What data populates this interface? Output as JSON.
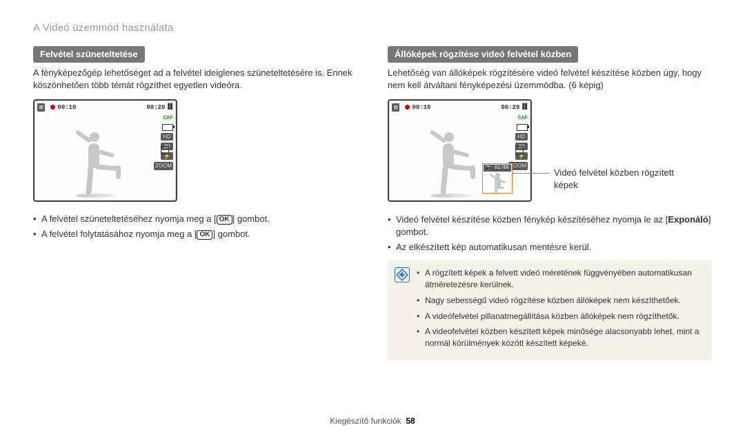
{
  "page_header": "A Videó üzemmód használata",
  "left": {
    "title": "Felvétel szüneteltetése",
    "intro": "A fényképezőgép lehetőséget ad a felvétel ideiglenes szüneteltetésére is. Ennek köszönhetően több témát rögzíthet egyetlen videóra.",
    "bullets": {
      "a_pre": "A felvétel szüneteltetéséhez nyomja meg a [",
      "a_post": "] gombot.",
      "b_pre": "A felvétel folytatásához nyomja meg a [",
      "b_post": "] gombot."
    }
  },
  "right": {
    "title": "Állóképek rögzítése videó felvétel közben",
    "intro": "Lehetőség van állóképek rögzítésére videó felvétel készítése közben úgy, hogy nem kell átváltani fényképezési üzemmódba. (6 képig)",
    "callout": "Videó felvétel közben rögzített képek",
    "bullets": {
      "a_pre": "Videó felvétel készítése közben fénykép készítéséhez nyomja le az [",
      "a_bold": "Exponáló",
      "a_post": "] gombot.",
      "b": "Az elkészített kép automatikusan mentésre kerül."
    },
    "notes": {
      "n1": "A rögzített képek a felvett videó méretének függvényében automatikusan átméretezésre kerülnek.",
      "n2": "Nagy sebességű videó rögzítése közben állóképek nem készíthetőek.",
      "n3": "A videófelvétel pillanatmegállítása közben állóképek nem rögzíthetők.",
      "n4": "A videofelvétel közben készített képek minősége alacsonyabb lehet, mint a normál körülmények között készített képeké."
    }
  },
  "cam": {
    "time_left": "00:10",
    "time_right": "00:20",
    "caf": "CAF",
    "thumb_counter": "01/06"
  },
  "footer": {
    "section": "Kiegészítő funkciók",
    "page": "58"
  },
  "ok_label": "OK"
}
